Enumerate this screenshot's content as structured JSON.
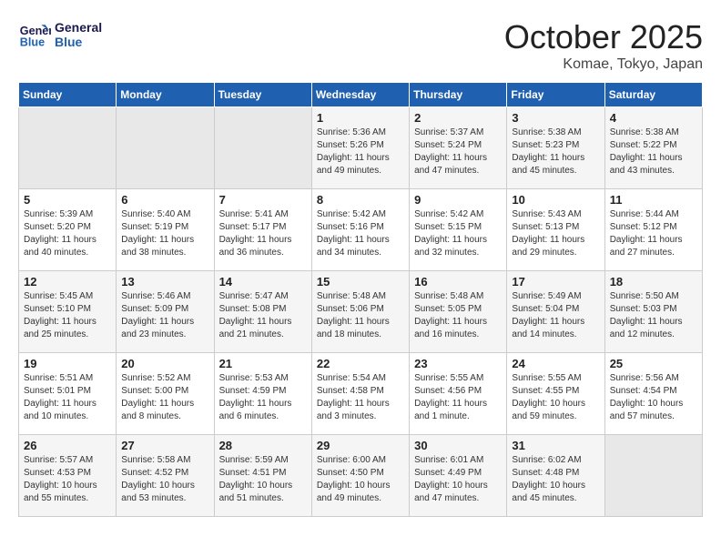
{
  "header": {
    "logo_line1": "General",
    "logo_line2": "Blue",
    "month": "October 2025",
    "location": "Komae, Tokyo, Japan"
  },
  "weekdays": [
    "Sunday",
    "Monday",
    "Tuesday",
    "Wednesday",
    "Thursday",
    "Friday",
    "Saturday"
  ],
  "weeks": [
    [
      {
        "day": "",
        "info": ""
      },
      {
        "day": "",
        "info": ""
      },
      {
        "day": "",
        "info": ""
      },
      {
        "day": "1",
        "info": "Sunrise: 5:36 AM\nSunset: 5:26 PM\nDaylight: 11 hours\nand 49 minutes."
      },
      {
        "day": "2",
        "info": "Sunrise: 5:37 AM\nSunset: 5:24 PM\nDaylight: 11 hours\nand 47 minutes."
      },
      {
        "day": "3",
        "info": "Sunrise: 5:38 AM\nSunset: 5:23 PM\nDaylight: 11 hours\nand 45 minutes."
      },
      {
        "day": "4",
        "info": "Sunrise: 5:38 AM\nSunset: 5:22 PM\nDaylight: 11 hours\nand 43 minutes."
      }
    ],
    [
      {
        "day": "5",
        "info": "Sunrise: 5:39 AM\nSunset: 5:20 PM\nDaylight: 11 hours\nand 40 minutes."
      },
      {
        "day": "6",
        "info": "Sunrise: 5:40 AM\nSunset: 5:19 PM\nDaylight: 11 hours\nand 38 minutes."
      },
      {
        "day": "7",
        "info": "Sunrise: 5:41 AM\nSunset: 5:17 PM\nDaylight: 11 hours\nand 36 minutes."
      },
      {
        "day": "8",
        "info": "Sunrise: 5:42 AM\nSunset: 5:16 PM\nDaylight: 11 hours\nand 34 minutes."
      },
      {
        "day": "9",
        "info": "Sunrise: 5:42 AM\nSunset: 5:15 PM\nDaylight: 11 hours\nand 32 minutes."
      },
      {
        "day": "10",
        "info": "Sunrise: 5:43 AM\nSunset: 5:13 PM\nDaylight: 11 hours\nand 29 minutes."
      },
      {
        "day": "11",
        "info": "Sunrise: 5:44 AM\nSunset: 5:12 PM\nDaylight: 11 hours\nand 27 minutes."
      }
    ],
    [
      {
        "day": "12",
        "info": "Sunrise: 5:45 AM\nSunset: 5:10 PM\nDaylight: 11 hours\nand 25 minutes."
      },
      {
        "day": "13",
        "info": "Sunrise: 5:46 AM\nSunset: 5:09 PM\nDaylight: 11 hours\nand 23 minutes."
      },
      {
        "day": "14",
        "info": "Sunrise: 5:47 AM\nSunset: 5:08 PM\nDaylight: 11 hours\nand 21 minutes."
      },
      {
        "day": "15",
        "info": "Sunrise: 5:48 AM\nSunset: 5:06 PM\nDaylight: 11 hours\nand 18 minutes."
      },
      {
        "day": "16",
        "info": "Sunrise: 5:48 AM\nSunset: 5:05 PM\nDaylight: 11 hours\nand 16 minutes."
      },
      {
        "day": "17",
        "info": "Sunrise: 5:49 AM\nSunset: 5:04 PM\nDaylight: 11 hours\nand 14 minutes."
      },
      {
        "day": "18",
        "info": "Sunrise: 5:50 AM\nSunset: 5:03 PM\nDaylight: 11 hours\nand 12 minutes."
      }
    ],
    [
      {
        "day": "19",
        "info": "Sunrise: 5:51 AM\nSunset: 5:01 PM\nDaylight: 11 hours\nand 10 minutes."
      },
      {
        "day": "20",
        "info": "Sunrise: 5:52 AM\nSunset: 5:00 PM\nDaylight: 11 hours\nand 8 minutes."
      },
      {
        "day": "21",
        "info": "Sunrise: 5:53 AM\nSunset: 4:59 PM\nDaylight: 11 hours\nand 6 minutes."
      },
      {
        "day": "22",
        "info": "Sunrise: 5:54 AM\nSunset: 4:58 PM\nDaylight: 11 hours\nand 3 minutes."
      },
      {
        "day": "23",
        "info": "Sunrise: 5:55 AM\nSunset: 4:56 PM\nDaylight: 11 hours\nand 1 minute."
      },
      {
        "day": "24",
        "info": "Sunrise: 5:55 AM\nSunset: 4:55 PM\nDaylight: 10 hours\nand 59 minutes."
      },
      {
        "day": "25",
        "info": "Sunrise: 5:56 AM\nSunset: 4:54 PM\nDaylight: 10 hours\nand 57 minutes."
      }
    ],
    [
      {
        "day": "26",
        "info": "Sunrise: 5:57 AM\nSunset: 4:53 PM\nDaylight: 10 hours\nand 55 minutes."
      },
      {
        "day": "27",
        "info": "Sunrise: 5:58 AM\nSunset: 4:52 PM\nDaylight: 10 hours\nand 53 minutes."
      },
      {
        "day": "28",
        "info": "Sunrise: 5:59 AM\nSunset: 4:51 PM\nDaylight: 10 hours\nand 51 minutes."
      },
      {
        "day": "29",
        "info": "Sunrise: 6:00 AM\nSunset: 4:50 PM\nDaylight: 10 hours\nand 49 minutes."
      },
      {
        "day": "30",
        "info": "Sunrise: 6:01 AM\nSunset: 4:49 PM\nDaylight: 10 hours\nand 47 minutes."
      },
      {
        "day": "31",
        "info": "Sunrise: 6:02 AM\nSunset: 4:48 PM\nDaylight: 10 hours\nand 45 minutes."
      },
      {
        "day": "",
        "info": ""
      }
    ]
  ]
}
